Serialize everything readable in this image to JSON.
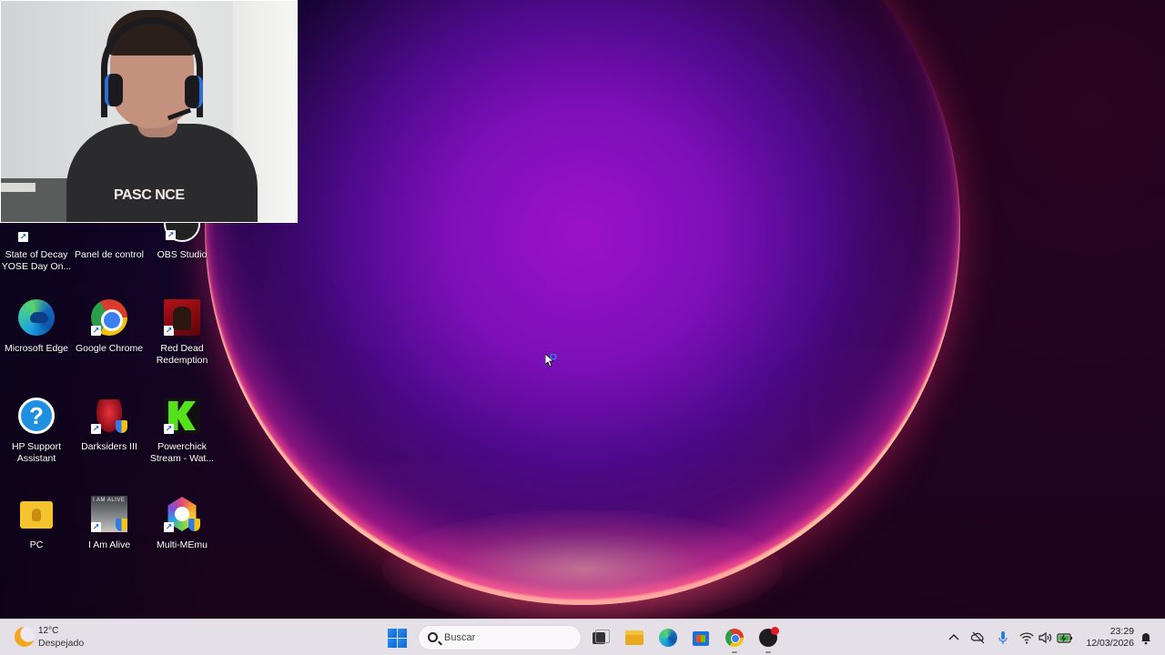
{
  "desktop": {
    "icons": [
      {
        "label": "State of Decay YOSE Day On...",
        "icon": "state-of-decay-icon"
      },
      {
        "label": "Panel de control",
        "icon": "control-panel-icon"
      },
      {
        "label": "OBS Studio",
        "icon": "obs-studio-icon"
      },
      {
        "label": "Microsoft Edge",
        "icon": "edge-icon"
      },
      {
        "label": "Google Chrome",
        "icon": "chrome-icon"
      },
      {
        "label": "Red Dead Redemption",
        "icon": "red-dead-redemption-icon"
      },
      {
        "label": "HP Support Assistant",
        "icon": "hp-support-icon"
      },
      {
        "label": "Darksiders III",
        "icon": "darksiders-icon"
      },
      {
        "label": "Powerchick Stream - Wat...",
        "icon": "powerchick-icon"
      },
      {
        "label": "PC",
        "icon": "pc-folder-icon"
      },
      {
        "label": "I Am Alive",
        "icon": "i-am-alive-icon"
      },
      {
        "label": "Multi-MEmu",
        "icon": "multi-memu-icon"
      }
    ]
  },
  "webcam": {
    "shirt_print": "PASC NCE"
  },
  "taskbar": {
    "weather": {
      "temperature": "12°C",
      "condition": "Despejado",
      "icon": "moon-icon"
    },
    "search": {
      "placeholder": "Buscar"
    },
    "apps": [
      "start-icon",
      "task-view-icon",
      "file-explorer-icon",
      "edge-icon",
      "microsoft-store-icon",
      "chrome-icon",
      "obs-icon"
    ],
    "tray": [
      "chevron-up-icon",
      "cloud-off-icon",
      "microphone-icon",
      "wifi-icon",
      "volume-icon",
      "battery-icon",
      "notification-icon"
    ],
    "clock": {
      "time": "23:29",
      "date": "12/03/2026"
    }
  },
  "colors": {
    "wallpaper_center": "#9b12c9",
    "wallpaper_edge": "#0c0421",
    "bloom_ring": "#ff4d8a",
    "taskbar_bg": "#eee8f0"
  }
}
